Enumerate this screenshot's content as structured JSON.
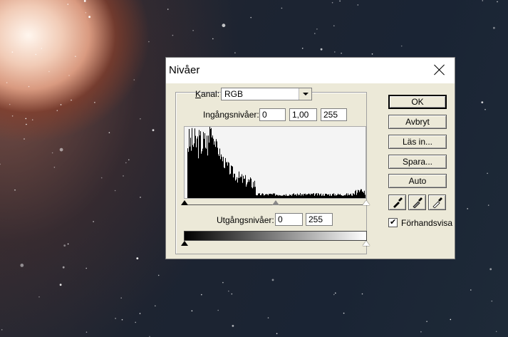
{
  "dialog": {
    "title": "Nivåer",
    "channel_label": "Kanal:",
    "channel_value": "RGB",
    "input_levels_label": "Ingångsnivåer:",
    "input_black": "0",
    "input_gamma": "1,00",
    "input_white": "255",
    "output_levels_label": "Utgångsnivåer:",
    "output_black": "0",
    "output_white": "255",
    "buttons": {
      "ok": "OK",
      "cancel": "Avbryt",
      "load": "Läs in...",
      "save": "Spara...",
      "auto": "Auto"
    },
    "preview_label": "Förhandsvisa",
    "preview_checked": "✔"
  }
}
